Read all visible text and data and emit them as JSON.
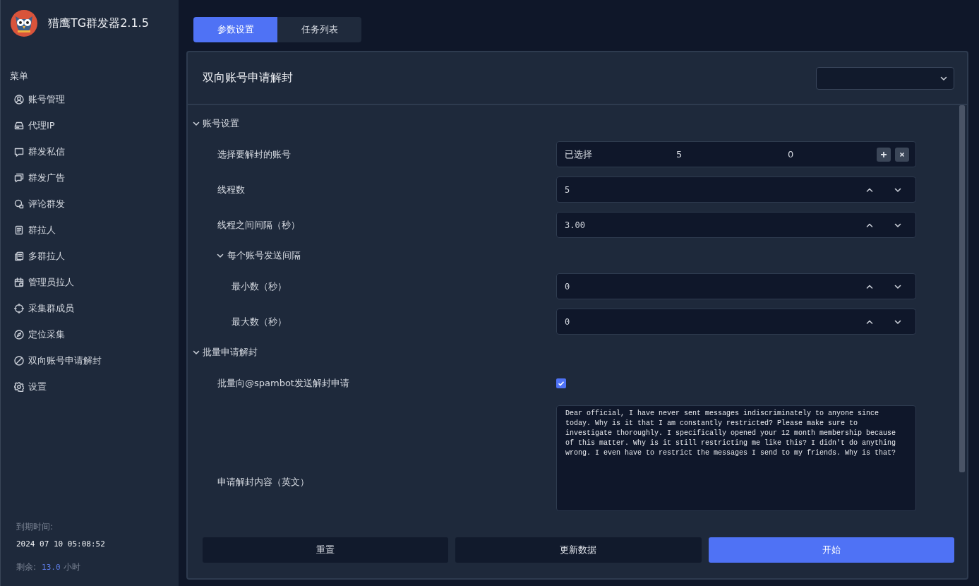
{
  "app": {
    "title": "猎鹰TG群发器2.1.5"
  },
  "sidebar": {
    "heading": "菜单",
    "items": [
      {
        "label": "账号管理"
      },
      {
        "label": "代理IP"
      },
      {
        "label": "群发私信"
      },
      {
        "label": "群发广告"
      },
      {
        "label": "评论群发"
      },
      {
        "label": "群拉人"
      },
      {
        "label": "多群拉人"
      },
      {
        "label": "管理员拉人"
      },
      {
        "label": "采集群成员"
      },
      {
        "label": "定位采集"
      },
      {
        "label": "双向账号申请解封"
      },
      {
        "label": "设置"
      }
    ]
  },
  "expiry": {
    "label": "到期时间:",
    "value": "2024 07 10 05:08:52",
    "remaining_label": "剩余:",
    "remaining_value": "13.0",
    "remaining_unit": "小时"
  },
  "tabs": [
    {
      "label": "参数设置",
      "selected": true
    },
    {
      "label": "任务列表",
      "selected": false
    }
  ],
  "panel": {
    "title": "双向账号申请解封",
    "sections": [
      {
        "title": "账号设置",
        "expanded": true,
        "fields": [
          {
            "kind": "selection",
            "label": "选择要解封的账号",
            "prefix": "已选择",
            "value_1": "5",
            "value_2": "0"
          },
          {
            "kind": "spin",
            "label": "线程数",
            "value": "5"
          },
          {
            "kind": "spin",
            "label": "线程之间间隔（秒）",
            "value": "3.00"
          },
          {
            "kind": "group",
            "label": "每个账号发送间隔",
            "expanded": true,
            "children": [
              {
                "kind": "spin",
                "label": "最小数（秒）",
                "value": "0"
              },
              {
                "kind": "spin",
                "label": "最大数（秒）",
                "value": "0"
              }
            ]
          }
        ]
      },
      {
        "title": "批量申请解封",
        "expanded": true,
        "fields": [
          {
            "kind": "checkbox",
            "label": "批量向@spambot发送解封申请",
            "checked": true
          },
          {
            "kind": "textarea",
            "label": "申请解封内容（英文）",
            "value": "Dear official, I have never sent messages indiscriminately to anyone since today. Why is it that I am constantly restricted? Please make sure to investigate thoroughly. I specifically opened your 12 month membership because of this matter. Why is it still restricting me like this? I didn't do anything wrong. I even have to restrict the messages I send to my friends. Why is that?"
          }
        ]
      }
    ]
  },
  "buttons": [
    {
      "label": "重置",
      "primary": false
    },
    {
      "label": "更新数据",
      "primary": false
    },
    {
      "label": "开始",
      "primary": true
    }
  ]
}
